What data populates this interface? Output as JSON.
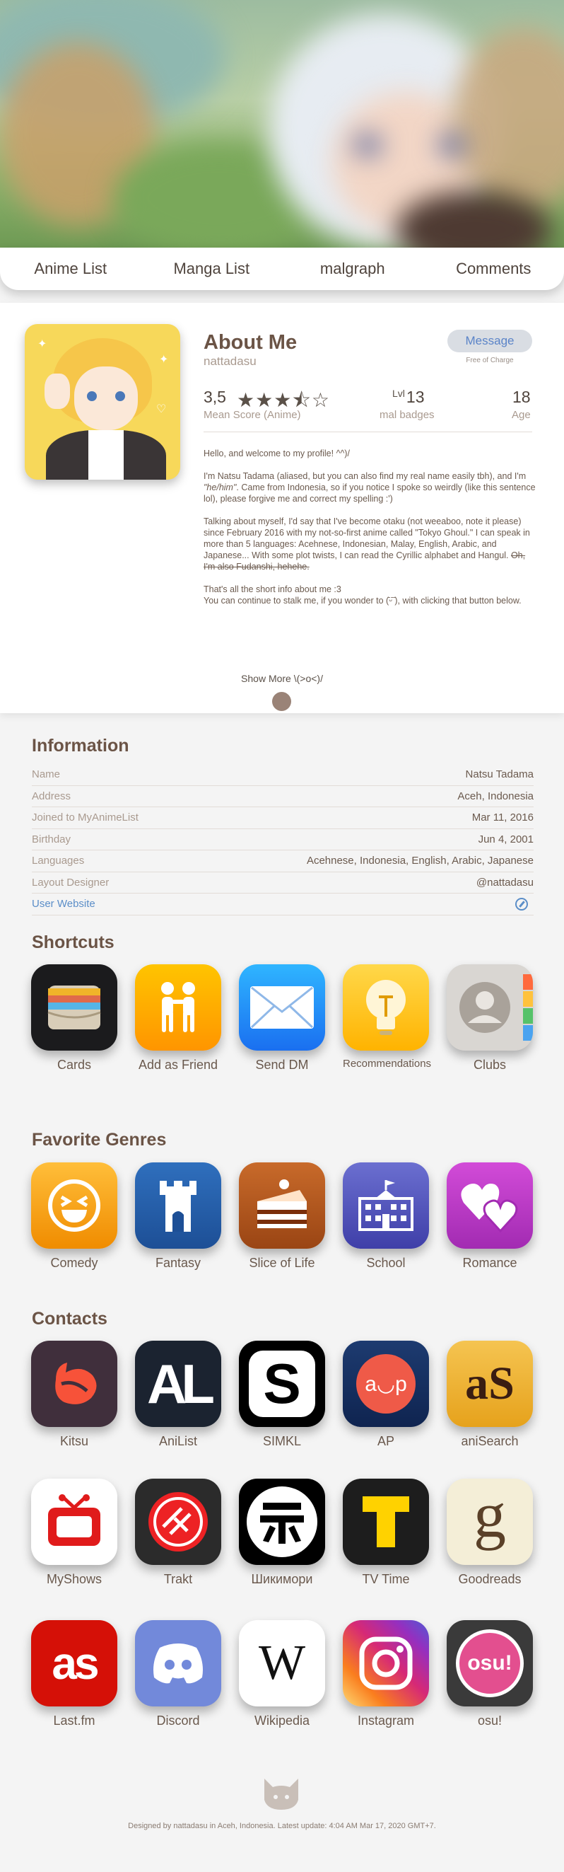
{
  "tabs": [
    "Anime List",
    "Manga List",
    "malgraph",
    "Comments"
  ],
  "about": {
    "title": "About Me",
    "username": "nattadasu",
    "message_label": "Message",
    "message_note": "Free of Charge",
    "mean_score": "3,5",
    "mean_score_label": "Mean Score (Anime)",
    "rating_stars": 3.5,
    "level_prefix": "Lvl",
    "level_value": "13",
    "badges_label": "mal badges",
    "age_value": "18",
    "age_label": "Age",
    "bio": {
      "p1": "Hello, and welcome to my profile! ^^)/",
      "p2_a": "I'm Natsu Tadama (aliased, but you can also find my real name easily tbh), and I'm ",
      "p2_pronoun": "\"he/him\"",
      "p2_b": ". Came from Indonesia, so if you notice I spoke so weirdly (like this sentence lol), please forgive me and correct my spelling :')",
      "p3_a": "Talking about myself, I'd say that I've become otaku (not weeaboo, note it please) since February 2016 with my not-so-first anime called \"Tokyo Ghoul.\" I can speak in more than 5 languages: Acehnese, Indonesian, Malay, English, Arabic, and Japanese... With some plot twists, I can read the Cyrillic alphabet and Hangul. ",
      "p3_strike": "Oh, I'm also Fudanshi, hehehe.",
      "p4_a": "That's all the short info about me :3",
      "p4_b": "You can continue to stalk me, if you wonder to (̄ᵕ̄ ̄), with clicking that button below."
    },
    "show_more": "Show More \\(>o<)/"
  },
  "information": {
    "heading": "Information",
    "rows": [
      {
        "k": "Name",
        "v": "Natsu Tadama"
      },
      {
        "k": "Address",
        "v": "Aceh, Indonesia"
      },
      {
        "k": "Joined to MyAnimeList",
        "v": "Mar 11, 2016"
      },
      {
        "k": "Birthday",
        "v": "Jun 4, 2001"
      },
      {
        "k": "Languages",
        "v": "Acehnese, Indonesia, English, Arabic, Japanese"
      },
      {
        "k": "Layout Designer",
        "v": "@nattadasu"
      }
    ],
    "website_label": "User Website"
  },
  "shortcuts": {
    "heading": "Shortcuts",
    "items": [
      "Cards",
      "Add as Friend",
      "Send DM",
      "Recommendations",
      "Clubs"
    ]
  },
  "genres": {
    "heading": "Favorite Genres",
    "items": [
      "Comedy",
      "Fantasy",
      "Slice of Life",
      "School",
      "Romance"
    ]
  },
  "contacts": {
    "heading": "Contacts",
    "items": [
      "Kitsu",
      "AniList",
      "SIMKL",
      "AP",
      "aniSearch",
      "MyShows",
      "Trakt",
      "Шикимори",
      "TV Time",
      "Goodreads",
      "Last.fm",
      "Discord",
      "Wikipedia",
      "Instagram",
      "osu!"
    ],
    "glyphs": {
      "anilist": "AL",
      "simkl": "S",
      "ap": "a◡p",
      "anisearch": "aS",
      "goodreads": "g",
      "lastfm": "as",
      "wikipedia": "W",
      "osu": "osu!"
    }
  },
  "footer": "Designed by nattadasu in Aceh, Indonesia. Latest update: 4:04 AM Mar 17, 2020 GMT+7."
}
